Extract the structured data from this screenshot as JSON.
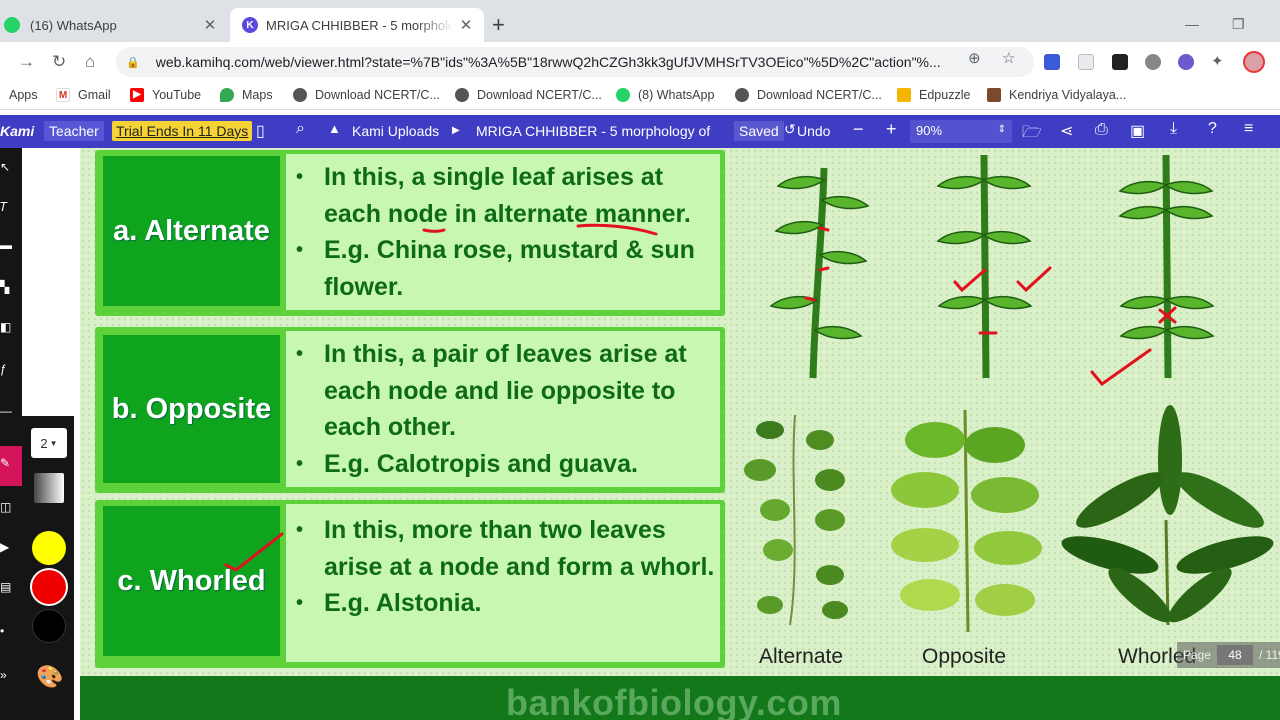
{
  "browser": {
    "tabs": [
      {
        "title": "(16) WhatsApp",
        "active": false
      },
      {
        "title": "MRIGA CHHIBBER - 5 morphology of",
        "active": true
      }
    ],
    "url": "web.kamihq.com/web/viewer.html?state=%7B\"ids\"%3A%5B\"18rwwQ2hCZGh3kk3gUfJVMHSrTV3OEico\"%5D%2C\"action\"%...",
    "bookmarks": [
      {
        "label": "Apps",
        "icon": "apps-grid-icon"
      },
      {
        "label": "Gmail",
        "icon": "gmail-icon"
      },
      {
        "label": "YouTube",
        "icon": "youtube-icon"
      },
      {
        "label": "Maps",
        "icon": "maps-icon"
      },
      {
        "label": "Download NCERT/C...",
        "icon": "globe-icon"
      },
      {
        "label": "Download NCERT/C...",
        "icon": "globe-icon"
      },
      {
        "label": "(8) WhatsApp",
        "icon": "whatsapp-icon"
      },
      {
        "label": "Download NCERT/C...",
        "icon": "globe-icon"
      },
      {
        "label": "Edpuzzle",
        "icon": "edpuzzle-icon"
      },
      {
        "label": "Kendriya Vidyalaya...",
        "icon": "kv-icon"
      }
    ]
  },
  "kami": {
    "logo": "Kami",
    "role": "Teacher",
    "trial": "Trial Ends In 11 Days",
    "breadcrumb_root": "Kami Uploads",
    "doc_title": "MRIGA CHHIBBER - 5 morphology of",
    "saved": "Saved",
    "undo": "Undo",
    "zoom": "90%",
    "pen_size": "2",
    "colors": {
      "yellow": "#ffff00",
      "red": "#ee0000",
      "black": "#000000",
      "accent": "#3f3dc4"
    }
  },
  "slide": {
    "rows": [
      {
        "label": "a. Alternate",
        "bullets": [
          "In this, a single leaf arises at each node in alternate manner.",
          "E.g. China rose, mustard & sun flower."
        ]
      },
      {
        "label": "b. Opposite",
        "bullets": [
          "In this, a pair of leaves arise at each node and lie opposite to each other.",
          "E.g. Calotropis and guava."
        ]
      },
      {
        "label": "c. Whorled",
        "bullets": [
          "In this, more than two leaves arise at a node and form a whorl.",
          "E.g. Alstonia."
        ]
      }
    ],
    "captions": [
      "Alternate",
      "Opposite",
      "Whorled"
    ],
    "watermark": "bankofbiology.com"
  },
  "pager": {
    "label": "Page",
    "current": "48",
    "total": "/ 119"
  }
}
